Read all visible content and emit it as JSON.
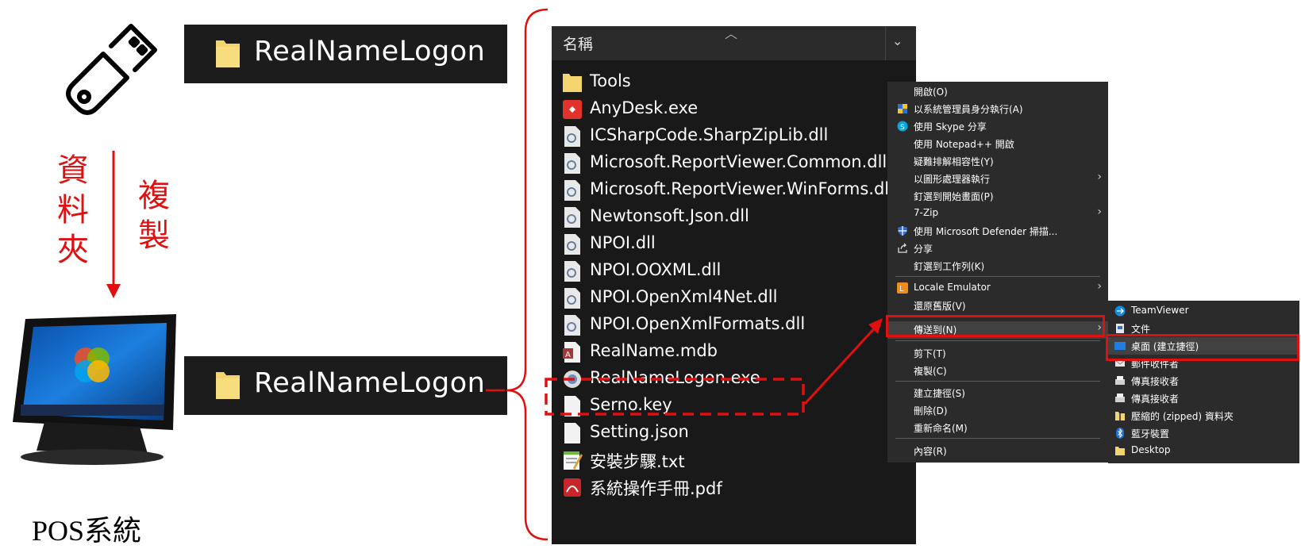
{
  "left": {
    "folder_top_label": "RealNameLogon",
    "folder_bottom_label": "RealNameLogon",
    "copy_caption_col1": [
      "資",
      "料",
      "夾"
    ],
    "copy_caption_col2": [
      "複",
      "製"
    ],
    "pos_label": "POS系統"
  },
  "explorer": {
    "column_header": "名稱",
    "files": [
      {
        "name": "Tools",
        "icon": "folder-icon"
      },
      {
        "name": "AnyDesk.exe",
        "icon": "anydesk-icon"
      },
      {
        "name": "ICSharpCode.SharpZipLib.dll",
        "icon": "dll-icon"
      },
      {
        "name": "Microsoft.ReportViewer.Common.dll",
        "icon": "dll-icon"
      },
      {
        "name": "Microsoft.ReportViewer.WinForms.dll",
        "icon": "dll-icon"
      },
      {
        "name": "Newtonsoft.Json.dll",
        "icon": "dll-icon"
      },
      {
        "name": "NPOI.dll",
        "icon": "dll-icon"
      },
      {
        "name": "NPOI.OOXML.dll",
        "icon": "dll-icon"
      },
      {
        "name": "NPOI.OpenXml4Net.dll",
        "icon": "dll-icon"
      },
      {
        "name": "NPOI.OpenXmlFormats.dll",
        "icon": "dll-icon"
      },
      {
        "name": "RealName.mdb",
        "icon": "access-db-icon"
      },
      {
        "name": "RealNameLogon.exe",
        "icon": "app-exe-icon"
      },
      {
        "name": "Serno.key",
        "icon": "blank-file-icon"
      },
      {
        "name": "Setting.json",
        "icon": "blank-file-icon"
      },
      {
        "name": "安裝步驟.txt",
        "icon": "notepad-icon"
      },
      {
        "name": "系統操作手冊.pdf",
        "icon": "pdf-icon"
      }
    ]
  },
  "context_menu": {
    "items": [
      {
        "label": "開啟(O)",
        "icon": ""
      },
      {
        "label": "以系統管理員身分執行(A)",
        "icon": "shield-icon"
      },
      {
        "label": "使用 Skype 分享",
        "icon": "skype-icon"
      },
      {
        "label": "使用 Notepad++ 開啟",
        "icon": ""
      },
      {
        "label": "疑難排解相容性(Y)",
        "icon": ""
      },
      {
        "label": "以圖形處理器執行",
        "icon": "",
        "submenu": true
      },
      {
        "label": "釘選到開始畫面(P)",
        "icon": ""
      },
      {
        "label": "7-Zip",
        "icon": "",
        "submenu": true
      },
      {
        "label": "使用 Microsoft Defender 掃描...",
        "icon": "defender-icon"
      },
      {
        "label": "分享",
        "icon": "share-icon"
      },
      {
        "label": "釘選到工作列(K)",
        "icon": ""
      },
      {
        "label": "Locale Emulator",
        "icon": "locale-emulator-icon",
        "submenu": true
      },
      {
        "label": "還原舊版(V)",
        "icon": ""
      },
      {
        "label": "傳送到(N)",
        "icon": "",
        "submenu": true
      },
      {
        "label": "剪下(T)",
        "icon": ""
      },
      {
        "label": "複製(C)",
        "icon": ""
      },
      {
        "label": "建立捷徑(S)",
        "icon": ""
      },
      {
        "label": "刪除(D)",
        "icon": ""
      },
      {
        "label": "重新命名(M)",
        "icon": ""
      },
      {
        "label": "內容(R)",
        "icon": ""
      }
    ]
  },
  "send_to_menu": {
    "items": [
      {
        "label": "TeamViewer",
        "icon": "teamviewer-icon"
      },
      {
        "label": "文件",
        "icon": "document-icon"
      },
      {
        "label": "桌面 (建立捷徑)",
        "icon": "desktop-icon"
      },
      {
        "label": "郵件收件者",
        "icon": "mail-icon"
      },
      {
        "label": "傳真接收者",
        "icon": "fax-icon"
      },
      {
        "label": "傳真接收者",
        "icon": "fax-icon"
      },
      {
        "label": "壓縮的 (zipped) 資料夾",
        "icon": "zip-folder-icon"
      },
      {
        "label": "藍牙裝置",
        "icon": "bluetooth-icon"
      },
      {
        "label": "Desktop",
        "icon": "folder-icon"
      }
    ]
  },
  "colors": {
    "annotation_red": "#e01010",
    "folder_yellow": "#f3d46f",
    "menu_bg": "#2b2b2b",
    "explorer_bg": "#191919"
  }
}
